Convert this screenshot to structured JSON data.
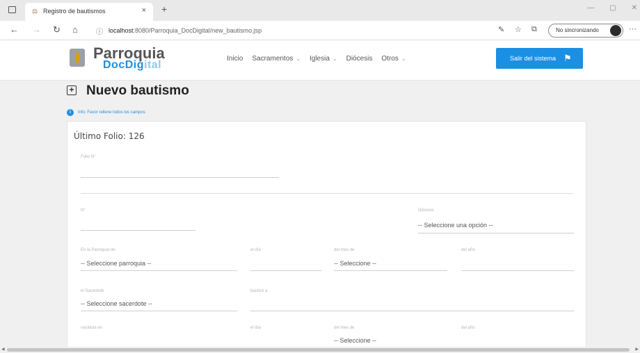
{
  "browser": {
    "tab_title": "Registro de bautismos",
    "tab_close": "×",
    "new_tab": "+",
    "url_host": "localhost",
    "url_path": ":8080/Parroquia_DocDigital/new_bautismo.jsp",
    "profile_label": "No sincronizando",
    "window_minimize": "—",
    "window_restore": "▢",
    "window_close": "✕"
  },
  "header": {
    "logo_title": "Parroquia",
    "logo_sub_strong": "DocDig",
    "logo_sub_light": "ital",
    "nav": [
      {
        "label": "Inicio",
        "dropdown": false
      },
      {
        "label": "Sacramentos",
        "dropdown": true
      },
      {
        "label": "Iglesia",
        "dropdown": true
      },
      {
        "label": "Diócesis",
        "dropdown": false
      },
      {
        "label": "Otros",
        "dropdown": true
      }
    ],
    "exit_button": "Salir del sistema"
  },
  "page": {
    "title": "Nuevo bautismo",
    "info_text": "Info: Favor rellene todos los campos",
    "folio": "Último Folio: 126"
  },
  "form": {
    "folio_label": "Folio N°",
    "num_label": "N°",
    "diocesis_label": "Diócesis",
    "diocesis_value": "-- Seleccione una opción --",
    "parroquia_label": "En la Parroquia de",
    "parroquia_value": "-- Seleccione parroquia --",
    "dia_label": "el día",
    "mes_label": "del mes de",
    "mes_value": "-- Seleccione --",
    "anio_label": "del año",
    "sacerdote_label": "el Sacerdote",
    "sacerdote_value": "-- Seleccione sacerdote --",
    "bautizo_label": "bautizó a",
    "nacido_label": "nacido/a en",
    "dia2_label": "el día",
    "mes2_label": "del mes de",
    "mes2_value": "-- Seleccione --",
    "anio2_label": "del año"
  },
  "colors": {
    "accent": "#1a8fe3",
    "page_bg": "#f0f0f0",
    "card_bg": "#ffffff"
  },
  "icons": [
    "window-icon",
    "tab-favicon",
    "back-icon",
    "forward-icon",
    "reload-icon",
    "home-icon",
    "info-icon",
    "read-aloud-icon",
    "favorite-icon",
    "collections-icon",
    "avatar",
    "more-icon",
    "logo-icon",
    "exit-icon",
    "plus-square-icon"
  ]
}
